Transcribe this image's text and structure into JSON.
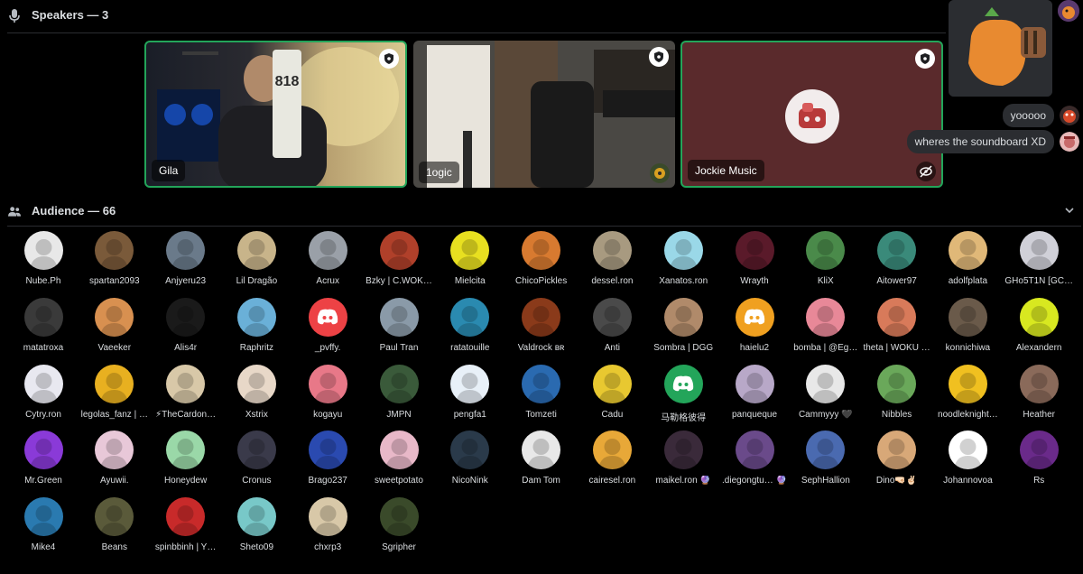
{
  "speakers": {
    "title": "Speakers — 3",
    "tiles": [
      {
        "name": "Gila"
      },
      {
        "name": "1ogic"
      },
      {
        "name": "Jockie Music"
      }
    ]
  },
  "chat": {
    "messages": [
      {
        "text": "yooooo"
      },
      {
        "text": "wheres the soundboard XD"
      }
    ]
  },
  "audience": {
    "title": "Audience — 66",
    "members": [
      {
        "name": "Nube.Ph",
        "color": "#e8e8e8"
      },
      {
        "name": "spartan2093",
        "color": "#7a5a3a"
      },
      {
        "name": "Anjyeru23",
        "color": "#6a7a8a"
      },
      {
        "name": "Lil Dragão",
        "color": "#c8b48a"
      },
      {
        "name": "Acrux",
        "color": "#9aa0a8"
      },
      {
        "name": "Bzky | C.WOK…",
        "color": "#b0402a"
      },
      {
        "name": "Mielcita",
        "color": "#e8e020"
      },
      {
        "name": "ChicoPickles",
        "color": "#d87a30"
      },
      {
        "name": "dessel.ron",
        "color": "#a89a80"
      },
      {
        "name": "Xanatos.ron",
        "color": "#9ad8e8"
      },
      {
        "name": "Wrayth",
        "color": "#5a1a2a"
      },
      {
        "name": "KliX",
        "color": "#4a8a4a"
      },
      {
        "name": "Aitower97",
        "color": "#3a8a7a"
      },
      {
        "name": "adolfplata",
        "color": "#e0b878"
      },
      {
        "name": "GHo5T1N [GC…",
        "color": "#d0d0d8"
      },
      {
        "name": "matatroxa",
        "color": "#3a3a3a"
      },
      {
        "name": "Vaeeker",
        "color": "#d89050"
      },
      {
        "name": "Alis4r",
        "color": "#1a1a1a"
      },
      {
        "name": "Raphritz",
        "color": "#6ab0d8"
      },
      {
        "name": "_pvffy.",
        "color": "#ed4245"
      },
      {
        "name": "Paul Tran",
        "color": "#8a9aa8"
      },
      {
        "name": "ratatouille",
        "color": "#2a8ab0"
      },
      {
        "name": "Valdrock ʙʀ",
        "color": "#8a3a1a"
      },
      {
        "name": "Anti",
        "color": "#4a4a4a"
      },
      {
        "name": "Sombra | DGG",
        "color": "#b08a6a"
      },
      {
        "name": "haielu2",
        "color": "#f0a020"
      },
      {
        "name": "bomba | @Eg…",
        "color": "#e88898"
      },
      {
        "name": "theta | WOKU …",
        "color": "#d87a5a"
      },
      {
        "name": "konnichiwa",
        "color": "#6a5a4a"
      },
      {
        "name": "Alexandern",
        "color": "#d8e820"
      },
      {
        "name": "Cytry.ron",
        "color": "#e8e8f0"
      },
      {
        "name": "legolas_fanz | …",
        "color": "#e8b020"
      },
      {
        "name": "⚡TheCardon…",
        "color": "#d8c8a8"
      },
      {
        "name": "Xstrix",
        "color": "#e8d8c8"
      },
      {
        "name": "kogayu",
        "color": "#e87888"
      },
      {
        "name": "JMPN",
        "color": "#3a5a3a"
      },
      {
        "name": "pengfa1",
        "color": "#e8f0f8"
      },
      {
        "name": "Tomzeti",
        "color": "#2a6ab0"
      },
      {
        "name": "Cadu",
        "color": "#e8c830"
      },
      {
        "name": "马勒格彼得",
        "color": "#23a55a"
      },
      {
        "name": "panqueque",
        "color": "#b8a8c8"
      },
      {
        "name": "Cammyyy 🖤",
        "color": "#e8e8e8"
      },
      {
        "name": "Nibbles",
        "color": "#6aa85a"
      },
      {
        "name": "noodleknight…",
        "color": "#f0c020"
      },
      {
        "name": "Heather",
        "color": "#8a6a5a"
      },
      {
        "name": "Mr.Green",
        "color": "#8a3ad8"
      },
      {
        "name": "Ayuwii.",
        "color": "#e8c8d8"
      },
      {
        "name": "Honeydew",
        "color": "#9ad8a8"
      },
      {
        "name": "Cronus",
        "color": "#3a3a4a"
      },
      {
        "name": "Brago237",
        "color": "#2a4ab0"
      },
      {
        "name": "sweetpotato",
        "color": "#e8b8c8"
      },
      {
        "name": "NicoNink",
        "color": "#2a3a4a"
      },
      {
        "name": "Dam Tom",
        "color": "#e8e8e8"
      },
      {
        "name": "cairesel.ron",
        "color": "#e8a838"
      },
      {
        "name": "maikel.ron 🔮",
        "color": "#3a2a3a"
      },
      {
        "name": ".diegongtu… 🔮",
        "color": "#6a4a8a"
      },
      {
        "name": "SephHallion",
        "color": "#4a6ab0"
      },
      {
        "name": "Dino🤜🏻✌🏻",
        "color": "#d8a878"
      },
      {
        "name": "Johannovoa",
        "color": "#ffffff"
      },
      {
        "name": "Rs",
        "color": "#6a2a8a"
      },
      {
        "name": "Mike4",
        "color": "#2a7ab0"
      },
      {
        "name": "Beans",
        "color": "#5a5a3a"
      },
      {
        "name": "spinbbinh | Y…",
        "color": "#c82a2a"
      },
      {
        "name": "Sheto09",
        "color": "#78c8c8"
      },
      {
        "name": "chxrp3",
        "color": "#d8c8a8"
      },
      {
        "name": "Sgripher",
        "color": "#3a4a2a"
      }
    ]
  },
  "colors": {
    "background": "#000000",
    "speaking_border": "#23a55a",
    "discord_blurple": "#ed4245",
    "bubble": "#2b2d31"
  },
  "icons": {
    "speakers_header": "microphone-icon",
    "audience_header": "people-icon",
    "collapse": "chevron-down-icon",
    "tile_badge": "moderator-badge-icon",
    "tile_corner": "video-off-icon"
  }
}
